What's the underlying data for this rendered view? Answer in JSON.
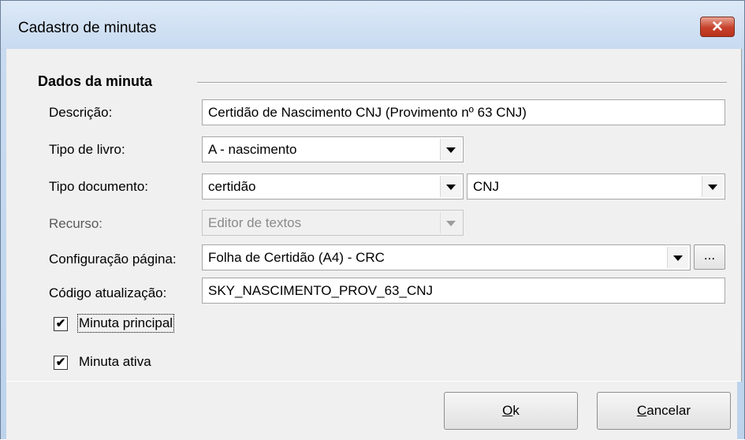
{
  "window": {
    "title": "Cadastro de minutas",
    "close_glyph": "✕"
  },
  "group": {
    "title": "Dados da minuta"
  },
  "labels": {
    "descricao": "Descrição:",
    "tipo_livro": "Tipo de livro:",
    "tipo_documento": "Tipo documento:",
    "recurso": "Recurso:",
    "config_pagina": "Configuração página:",
    "codigo_atualizacao": "Código atualização:"
  },
  "fields": {
    "descricao": "Certidão de Nascimento CNJ (Provimento nº 63 CNJ)",
    "tipo_livro": "A - nascimento",
    "tipo_documento": "certidão",
    "tipo_documento_sub": "CNJ",
    "recurso": "Editor de textos",
    "config_pagina": "Folha de Certidão (A4) - CRC",
    "codigo_atualizacao": "SKY_NASCIMENTO_PROV_63_CNJ"
  },
  "browse_button": "...",
  "checkboxes": {
    "principal": {
      "label": "Minuta principal",
      "checked": true,
      "mark": "✔"
    },
    "ativa": {
      "label": "Minuta ativa",
      "checked": true,
      "mark": "✔"
    }
  },
  "buttons": {
    "ok": {
      "label": "Ok",
      "mnemonic": "O",
      "rest": "k"
    },
    "cancelar": {
      "label": "Cancelar",
      "mnemonic": "C",
      "rest": "ancelar"
    }
  }
}
